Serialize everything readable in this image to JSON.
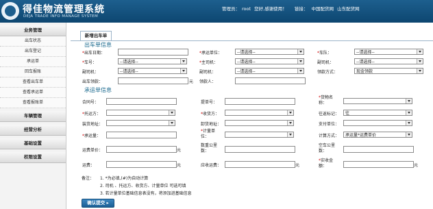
{
  "header": {
    "title": "得佳物流管理系统",
    "subtitle": "DEJA TRADE INFO MANAGE SYSTEM",
    "admin_label": "管理员：",
    "admin_name": "root",
    "greeting": "您好,感谢使用！",
    "links_label": "链接：",
    "link1": "中国配货网",
    "link2": "山东配货网"
  },
  "sidebar": {
    "section1": "业务管理",
    "items": [
      "出车状态",
      "出车登记",
      "承运单",
      "回车报账",
      "查看出车单",
      "查看承运单",
      "查看报账单"
    ],
    "section2": "车辆管理",
    "section3": "经营分析",
    "section4": "基础设置",
    "section5": "权限设置"
  },
  "tab": {
    "label": "新增出车单"
  },
  "dispatch": {
    "heading": "出车单信息",
    "out_date_label": "出车日期：",
    "carrier_unit_label": "承运单位：",
    "carrier_unit_value": "--请选择--",
    "team_label": "车队：",
    "team_value": "--请选择--",
    "vehicle_no_label": "车号：",
    "vehicle_no_value": "--请选择--",
    "main_driver_label": "主司机：",
    "main_driver_value": "--请选择--",
    "deputy_driver_label": "副司机：",
    "deputy_driver_value": "--请选择--",
    "deputy_car_label": "副司机：",
    "deputy_car_value": "--请选择--",
    "deputy_car2_label": "副司机：",
    "deputy_car2_value": "--请选择--",
    "pay_method_label": "领款方式：",
    "pay_method_value": "现金领款",
    "advance_label": "出车领款：",
    "advance_unit": "元",
    "receiver_label": "领款人："
  },
  "consign": {
    "heading": "承运单信息",
    "contract_label": "合同号：",
    "bill_label": "提单号：",
    "goods_label": "货物名称：",
    "goods_value": "",
    "ship_label": "托运方：",
    "ship_value": "",
    "receive_label": "收货方：",
    "receive_value": "",
    "return_label": "往返标记：",
    "return_value": "往",
    "load_addr_label": "装货地址：",
    "load_addr_value": "",
    "unload_addr_label": "卸货地址：",
    "unload_addr_value": "",
    "pay_unit_label": "支付单位：",
    "pay_unit_value": "",
    "qty_label": "承运量：",
    "measure_unit_label": "计量单位：",
    "measure_unit_value": "",
    "calc_method_label": "计算方式：",
    "calc_method_value": "承运量*运费单价",
    "unit_price_label": "运费单价：",
    "unit_price_unit": "元",
    "empty_km_label": "数重公里数：",
    "empty_km2_label": "空车公里数：",
    "freight_label": "运费：",
    "freight_unit": "元",
    "return_freight_label": "应收运费：",
    "return_freight_unit": "元",
    "actual_label": "实收金额：",
    "actual_unit": "元"
  },
  "notes": {
    "label": "备注：",
    "line1": "1. *为必填,(#)为自动计算",
    "line2": "2. 司机 、托运方、收货方、计量单位 可选可填",
    "line3": "3. 若计量单位基础信息表没有，将添加进基础信息"
  },
  "submit": {
    "label": "确认提交 ▸"
  }
}
